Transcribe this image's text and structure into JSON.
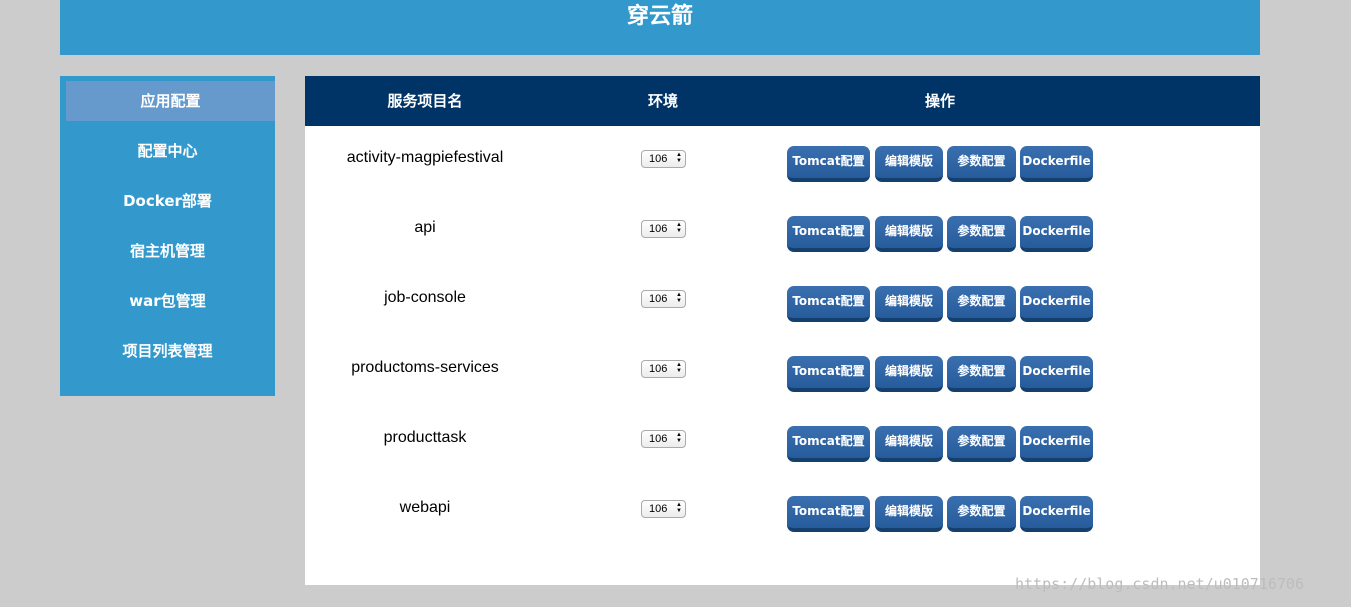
{
  "header": {
    "title": "穿云箭"
  },
  "sidebar": {
    "items": [
      {
        "label": "应用配置",
        "active": true
      },
      {
        "label": "配置中心",
        "active": false
      },
      {
        "label": "Docker部署",
        "active": false
      },
      {
        "label": "宿主机管理",
        "active": false
      },
      {
        "label": "war包管理",
        "active": false
      },
      {
        "label": "项目列表管理",
        "active": false
      }
    ]
  },
  "table": {
    "columns": [
      "服务项目名",
      "环境",
      "操作"
    ],
    "buttons": {
      "tomcat": "Tomcat配置",
      "template": "编辑模版",
      "params": "参数配置",
      "dockerfile": "Dockerfile"
    },
    "rows": [
      {
        "name": "activity-magpiefestival",
        "env": "106"
      },
      {
        "name": "api",
        "env": "106"
      },
      {
        "name": "job-console",
        "env": "106"
      },
      {
        "name": "productoms-services",
        "env": "106"
      },
      {
        "name": "producttask",
        "env": "106"
      },
      {
        "name": "webapi",
        "env": "106"
      }
    ]
  },
  "watermark": "https://blog.csdn.net/u010716706",
  "colors": {
    "header_bg": "#3399cc",
    "sidebar_bg": "#3399cc",
    "sidebar_active_bg": "#6699cc",
    "table_header_bg": "#003366",
    "button_bg": "#2f66a8",
    "page_bg": "#cccccc"
  }
}
